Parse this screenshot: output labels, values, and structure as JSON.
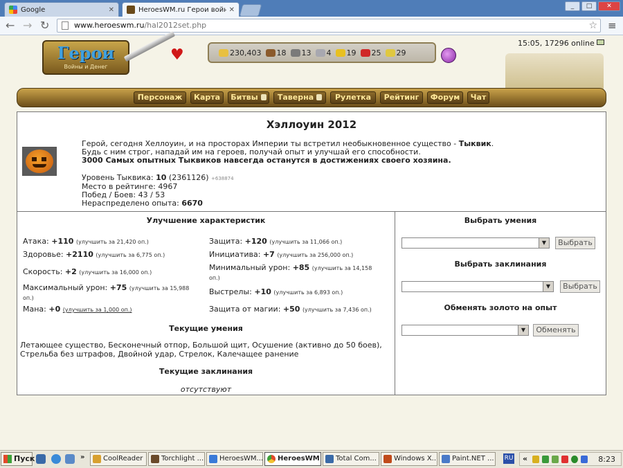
{
  "browser": {
    "tabs": [
      {
        "title": "Google",
        "active": false,
        "favicon": "google-icon"
      },
      {
        "title": "HeroesWM.ru Герои войны и",
        "active": true,
        "favicon": "heroes-icon"
      }
    ],
    "window_buttons": [
      "_",
      "□",
      "✕"
    ],
    "url_domain": "www.heroeswm.ru",
    "url_path": "/hal2012set.php"
  },
  "site": {
    "status": "15:05, 17296 online",
    "logo_title": "Герои",
    "logo_subtitle": "Войны и Денег",
    "resources": [
      {
        "icon": "gold-icon",
        "value": "230,403",
        "color": "#E8C040"
      },
      {
        "icon": "wood-icon",
        "value": "18",
        "color": "#8B5A2B"
      },
      {
        "icon": "ore-icon",
        "value": "13",
        "color": "#7A7A7A"
      },
      {
        "icon": "mercury-icon",
        "value": "4",
        "color": "#A8A8B0"
      },
      {
        "icon": "sulfur-icon",
        "value": "19",
        "color": "#E8C020"
      },
      {
        "icon": "crystal-icon",
        "value": "25",
        "color": "#D02828"
      },
      {
        "icon": "gems-icon",
        "value": "29",
        "color": "#E0C840"
      }
    ],
    "nav": [
      "Персонаж",
      "Карта",
      "Битвы",
      "Таверна",
      "Рулетка",
      "Рейтинг",
      "Форум",
      "Чат"
    ]
  },
  "event": {
    "title": "Хэллоуин 2012",
    "intro_1a": "Герой, сегодня Хеллоуин, и на просторах Империи ты встретил необыкновенное существо - ",
    "intro_1b": "Тыквик",
    "intro_1c": ".",
    "intro_2": "Будь с ним строг, нападай им на героев, получай опыт и улучшай его способности.",
    "intro_3": "3000 Самых опытных Тыквиков навсегда останутся в достижениях своего хозяина.",
    "level_label": "Уровень Тыквика: ",
    "level_value": "10",
    "level_exp": " (2361126) ",
    "level_extra": "+638874",
    "rank_line": "Место в рейтинге: 4967",
    "wins_line": "Побед / Боев: 43 / 53",
    "free_exp_label": "Нераспределено опыта: ",
    "free_exp_value": "6670"
  },
  "upgrades": {
    "heading": "Улучшение характеристик",
    "stats": [
      {
        "label": "Атака: ",
        "value": "+110",
        "up": "(улучшить за 21,420 оп.)"
      },
      {
        "label": "Защита: ",
        "value": "+120",
        "up": "(улучшить за 11,066 оп.)"
      },
      {
        "label": "Здоровье: ",
        "value": "+2110",
        "up": "(улучшить за 6,775 оп.)"
      },
      {
        "label": "Инициатива: ",
        "value": "+7",
        "up": "(улучшить за 256,000 оп.)"
      },
      {
        "label": "Скорость: ",
        "value": "+2",
        "up": "(улучшить за 16,000 оп.)"
      },
      {
        "label": "Минимальный урон: ",
        "value": "+85",
        "up": "(улучшить за 14,158 оп.)"
      },
      {
        "label": "Максимальный урон: ",
        "value": "+75",
        "up": "(улучшить за 15,988 оп.)"
      },
      {
        "label": "Выстрелы: ",
        "value": "+10",
        "up": "(улучшить за 6,893 оп.)"
      },
      {
        "label": "Мана: ",
        "value": "+0",
        "up": "(улучшить за 1,000 оп.)"
      },
      {
        "label": "Защита от магии: ",
        "value": "+50",
        "up": "(улучшить за 7,436 оп.)"
      }
    ],
    "skills_heading": "Текущие умения",
    "skills_text": "Летающее существо, Бесконечный отпор, Большой щит, Осушение (активно до 50 боев), Стрельба без штрафов, Двойной удар, Стрелок, Калечащее ранение",
    "spells_heading": "Текущие заклинания",
    "spells_text": "отсутствуют"
  },
  "right_panel": {
    "skills_heading": "Выбрать умения",
    "spells_heading": "Выбрать заклинания",
    "gold_heading": "Обменять золото на опыт",
    "choose_button": "Выбрать",
    "exchange_button": "Обменять",
    "dropdown_arrow": "▼"
  },
  "taskbar": {
    "start": "Пуск",
    "tasks": [
      {
        "label": "CoolReader",
        "active": false,
        "color": "#D8A030"
      },
      {
        "label": "Torchlight ...",
        "active": false,
        "color": "#6A4A2A"
      },
      {
        "label": "HeroesWM...",
        "active": false,
        "color": "#3A7AD8"
      },
      {
        "label": "HeroesWM",
        "active": true,
        "color": "#E04A2A"
      },
      {
        "label": "Total Com...",
        "active": false,
        "color": "#3A6AA8"
      },
      {
        "label": "Windows X...",
        "active": false,
        "color": "#C04A1A"
      },
      {
        "label": "Paint.NET ...",
        "active": false,
        "color": "#4A7AC8"
      }
    ],
    "lang": "RU",
    "clock": "8:23"
  }
}
